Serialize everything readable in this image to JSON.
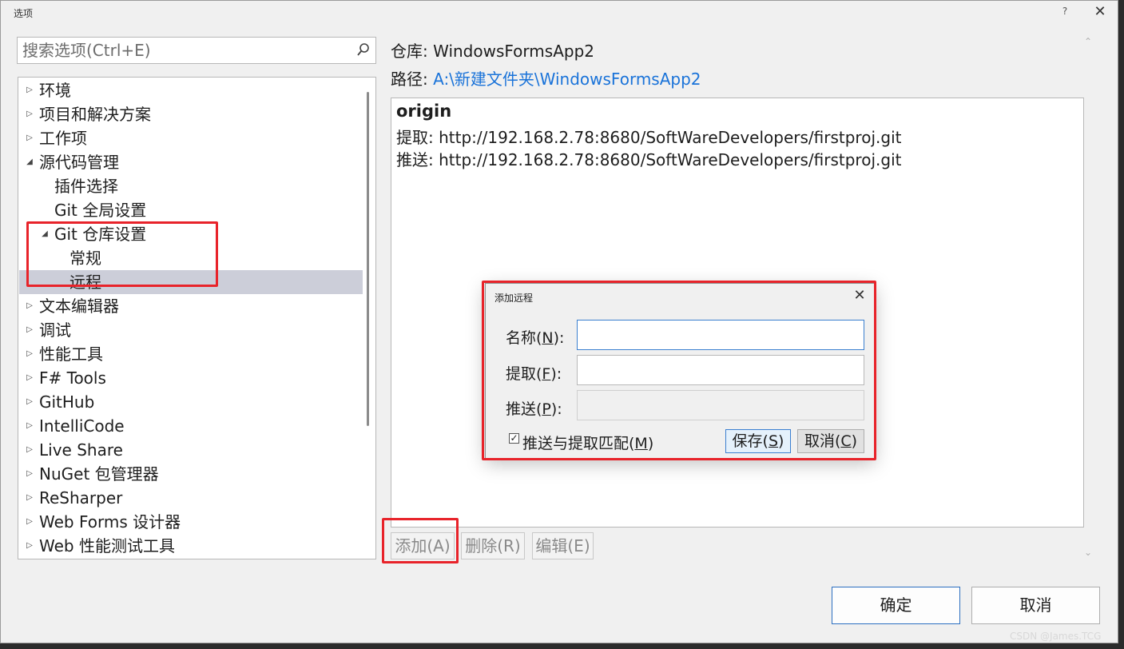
{
  "window": {
    "title": "选项",
    "help_glyph": "?",
    "close_glyph": "✕"
  },
  "search": {
    "placeholder": "搜索选项(Ctrl+E)",
    "value": ""
  },
  "tree": {
    "items": [
      {
        "label": "环境",
        "expander": "▷"
      },
      {
        "label": "项目和解决方案",
        "expander": "▷"
      },
      {
        "label": "工作项",
        "expander": "▷"
      },
      {
        "label": "源代码管理",
        "expander": "◢"
      },
      {
        "label": "插件选择",
        "expander": ""
      },
      {
        "label": "Git 全局设置",
        "expander": ""
      },
      {
        "label": "Git 仓库设置",
        "expander": "◢"
      },
      {
        "label": "常规",
        "expander": ""
      },
      {
        "label": "远程",
        "expander": ""
      },
      {
        "label": "文本编辑器",
        "expander": "▷"
      },
      {
        "label": "调试",
        "expander": "▷"
      },
      {
        "label": "性能工具",
        "expander": "▷"
      },
      {
        "label": "F# Tools",
        "expander": "▷"
      },
      {
        "label": "GitHub",
        "expander": "▷"
      },
      {
        "label": "IntelliCode",
        "expander": "▷"
      },
      {
        "label": "Live Share",
        "expander": "▷"
      },
      {
        "label": "NuGet 包管理器",
        "expander": "▷"
      },
      {
        "label": "ReSharper",
        "expander": "▷"
      },
      {
        "label": "Web Forms 设计器",
        "expander": "▷"
      },
      {
        "label": "Web 性能测试工具",
        "expander": "▷"
      }
    ]
  },
  "repo": {
    "repo_label": "仓库:",
    "repo_name": "WindowsFormsApp2",
    "path_label": "路径:",
    "path_value": "A:\\新建文件夹\\WindowsFormsApp2"
  },
  "remotes": {
    "name": "origin",
    "fetch_line": "提取: http://192.168.2.78:8680/SoftWareDevelopers/firstproj.git",
    "push_line": "推送: http://192.168.2.78:8680/SoftWareDevelopers/firstproj.git"
  },
  "remote_buttons": {
    "add": "添加(A)",
    "delete": "删除(R)",
    "edit": "编辑(E)"
  },
  "footer": {
    "ok": "确定",
    "cancel": "取消"
  },
  "dialog": {
    "title": "添加远程",
    "close_glyph": "✕",
    "name_label_pre": "名称(",
    "name_label_key": "N",
    "name_label_post": "):",
    "fetch_label_pre": "提取(",
    "fetch_label_key": "F",
    "fetch_label_post": "):",
    "push_label_pre": "推送(",
    "push_label_key": "P",
    "push_label_post": "):",
    "name_value": "",
    "fetch_value": "",
    "push_value": "",
    "checkbox_checked": true,
    "check_glyph": "✓",
    "checkbox_label_pre": "推送与提取匹配(",
    "checkbox_label_key": "M",
    "checkbox_label_post": ")",
    "save_pre": "保存(",
    "save_key": "S",
    "save_post": ")",
    "cancel_pre": "取消(",
    "cancel_key": "C",
    "cancel_post": ")"
  },
  "watermark": "CSDN @James.TCG",
  "colors": {
    "highlight": "#e8232a",
    "link": "#1a73d9",
    "selection": "#ccced9"
  }
}
